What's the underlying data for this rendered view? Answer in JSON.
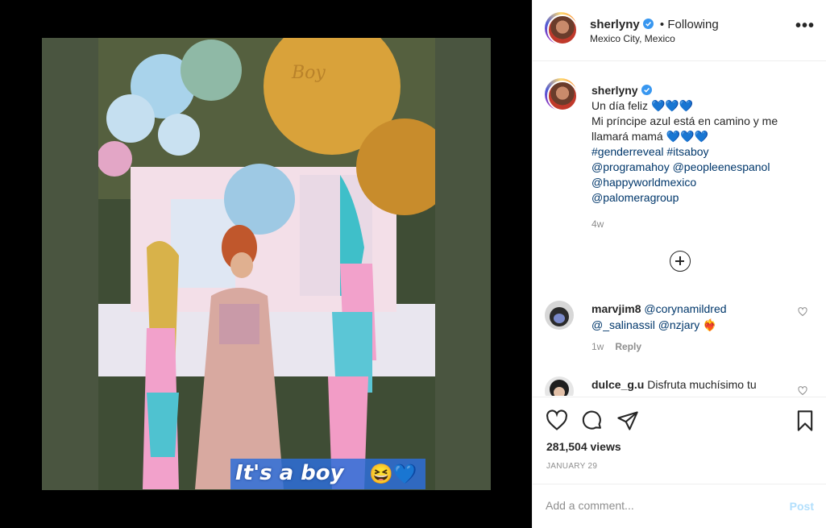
{
  "media": {
    "overlay_text": "It's a boy",
    "balloon_text": "Boy"
  },
  "header": {
    "username": "sherlyny",
    "separator": "•",
    "follow_status": "Following",
    "location": "Mexico City, Mexico",
    "more_label": "•••"
  },
  "caption": {
    "username": "sherlyny",
    "line1": "Un día feliz",
    "line2": "Mi príncipe azul está en camino y me llamará mamá",
    "hearts": "💙💙💙",
    "hashtags": "#genderreveal #itsaboy",
    "mention1": "@programahoy @peopleenespanol",
    "mention2": "@happyworldmexico",
    "mention3": "@palomeragroup",
    "time": "4w"
  },
  "comments": [
    {
      "username": "marvjim8",
      "mention_line1": "@corynamildred",
      "mention_line2": "@_salinassil @nzjary",
      "emoji": "❤️‍🔥",
      "time": "1w",
      "reply": "Reply"
    },
    {
      "username": "dulce_g.u",
      "text": "Disfruta muchísimo tu"
    }
  ],
  "actions": {
    "views": "281,504 views",
    "date": "JANUARY 29"
  },
  "add_comment": {
    "placeholder": "Add a comment...",
    "post_label": "Post"
  },
  "colors": {
    "accent_link": "#00376b",
    "verified": "#3897f0",
    "post_disabled": "#b2dffc",
    "heart_blue": "#1ec0f1"
  }
}
